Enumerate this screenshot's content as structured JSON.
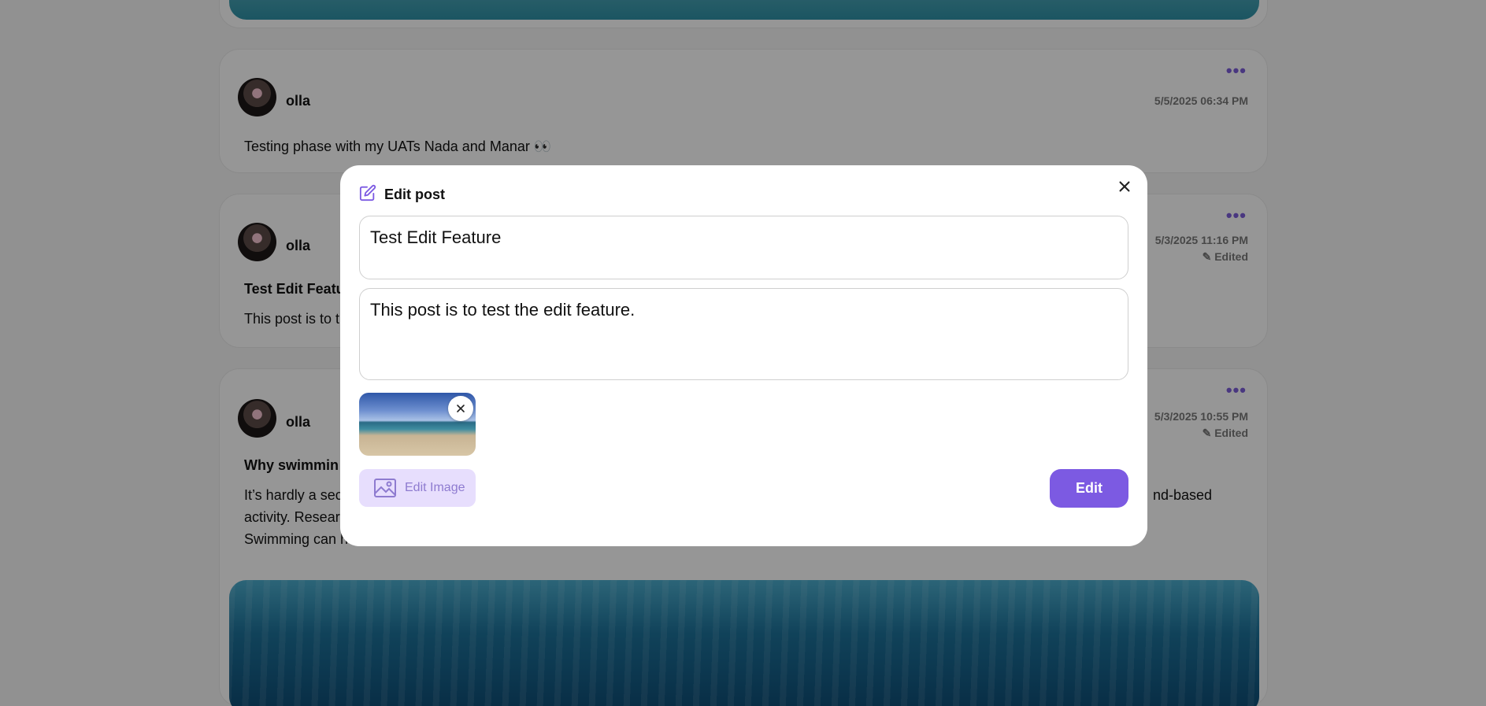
{
  "posts": [
    {
      "user": "olla",
      "date": "5/5/2025 06:34 PM",
      "text": "Testing phase with my UATs Nada and Manar 👀"
    },
    {
      "user": "olla",
      "date": "5/3/2025 11:16 PM",
      "edited": "Edited",
      "title": "Test Edit Featu",
      "text": "This post is to t"
    },
    {
      "user": "olla",
      "date": "5/3/2025 10:55 PM",
      "edited": "Edited",
      "title": "Why swimmin",
      "text_line1_left": "It’s hardly a sec",
      "text_line1_right": "nd-based",
      "text_line2": "activity. Resear",
      "text_line3": "Swimming can h"
    }
  ],
  "modal": {
    "title": "Edit post",
    "title_value": "Test Edit Feature",
    "body_value": "This post is to test the edit feature.",
    "edit_image_label": "Edit Image",
    "submit_label": "Edit"
  },
  "icons": {
    "header": "edit-pencil-icon",
    "close": "close-icon",
    "remove_image": "close-icon",
    "edit_image": "image-icon",
    "more": "more-dots-icon",
    "edited": "pencil-icon"
  },
  "colors": {
    "accent": "#7c5ae2",
    "accent_light": "#e7defd"
  }
}
